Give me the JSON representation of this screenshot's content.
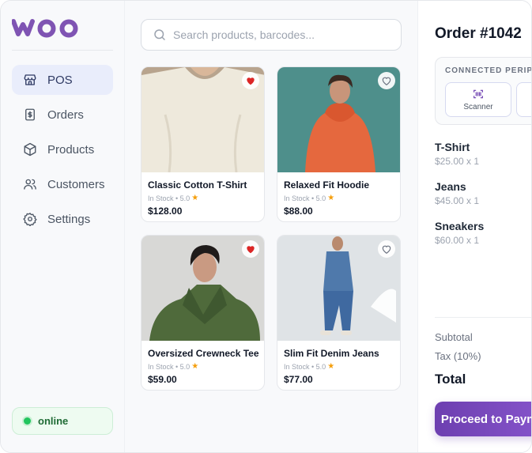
{
  "brand": {
    "logo_text": "woo",
    "accent": "#7f54b3"
  },
  "sidebar": {
    "items": [
      {
        "label": "POS",
        "icon": "store-icon",
        "active": true
      },
      {
        "label": "Orders",
        "icon": "receipt-icon",
        "active": false
      },
      {
        "label": "Products",
        "icon": "box-icon",
        "active": false
      },
      {
        "label": "Customers",
        "icon": "users-icon",
        "active": false
      },
      {
        "label": "Settings",
        "icon": "gear-icon",
        "active": false
      }
    ],
    "status": {
      "label": "online",
      "color": "#22c55e"
    }
  },
  "search": {
    "placeholder": "Search products, barcodes...",
    "value": ""
  },
  "products": [
    {
      "name": "Classic Cotton T-Shirt",
      "stock": "In Stock",
      "rating": "5.0",
      "price": "$128.00",
      "favorite": true
    },
    {
      "name": "Relaxed Fit Hoodie",
      "stock": "In Stock",
      "rating": "5.0",
      "price": "$88.00",
      "favorite": false
    },
    {
      "name": "Oversized Crewneck Tee",
      "stock": "In Stock",
      "rating": "5.0",
      "price": "$59.00",
      "favorite": true
    },
    {
      "name": "Slim Fit Denim Jeans",
      "stock": "In Stock",
      "rating": "5.0",
      "price": "$77.00",
      "favorite": false
    }
  ],
  "order": {
    "title": "Order #1042",
    "peripherals_label": "CONNECTED PERIPHERALS",
    "peripherals": [
      {
        "label": "Scanner",
        "icon": "scanner-icon"
      }
    ],
    "items": [
      {
        "name": "T-Shirt",
        "qty": "$25.00 x 1"
      },
      {
        "name": "Jeans",
        "qty": "$45.00 x 1"
      },
      {
        "name": "Sneakers",
        "qty": "$60.00 x 1"
      }
    ],
    "subtotal_label": "Subtotal",
    "tax_label": "Tax (10%)",
    "total_label": "Total",
    "proceed_label": "Proceed to Payment"
  }
}
